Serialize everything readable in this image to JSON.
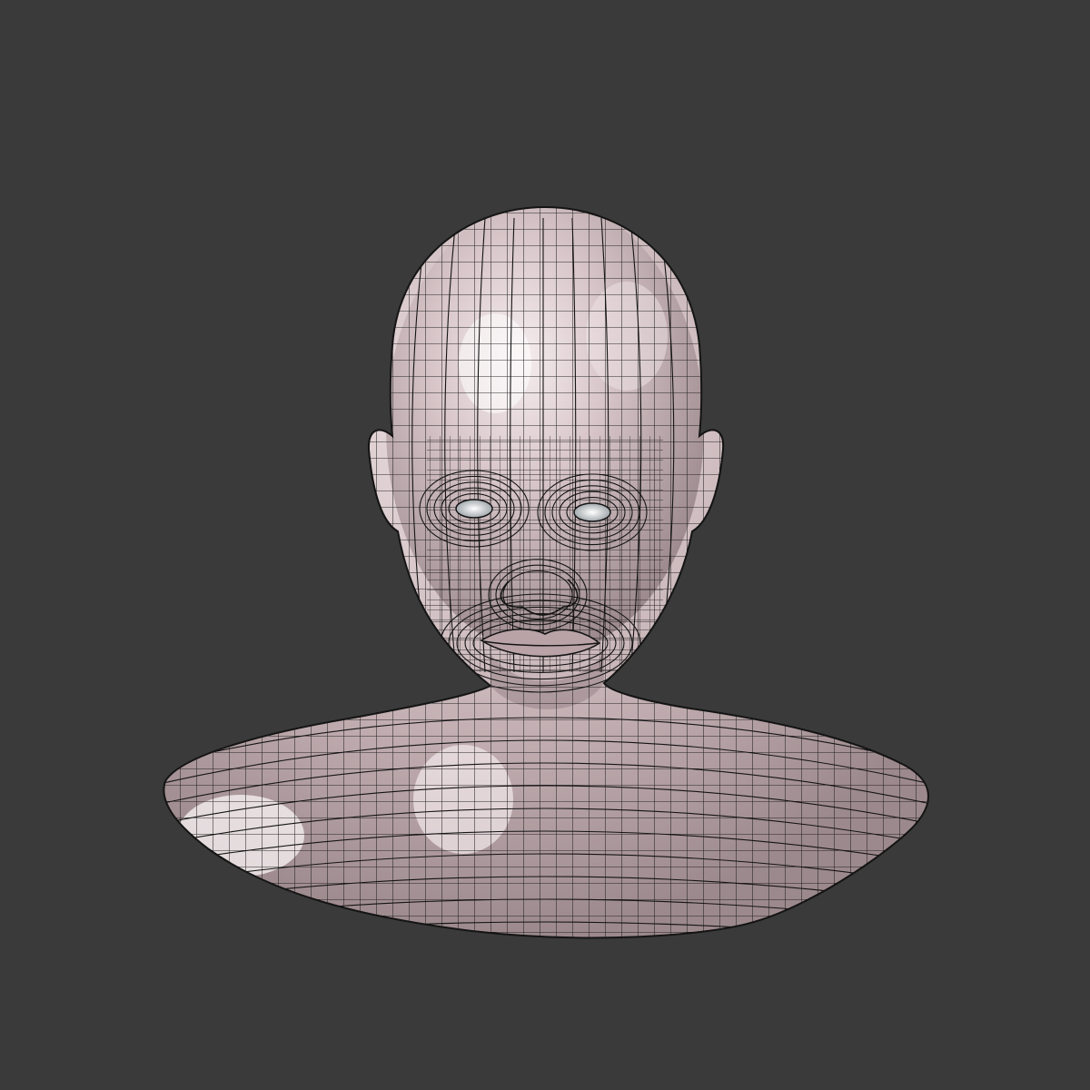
{
  "viewport": {
    "background": "#3a3a3a",
    "content": "wireframe-head-bust"
  },
  "model": {
    "skin_base": "#c9b6b8",
    "skin_highlight": "#f6eef0",
    "skin_shadow": "#8f7c80",
    "wire_color": "#141414",
    "eye_color": "#e8ecef"
  }
}
